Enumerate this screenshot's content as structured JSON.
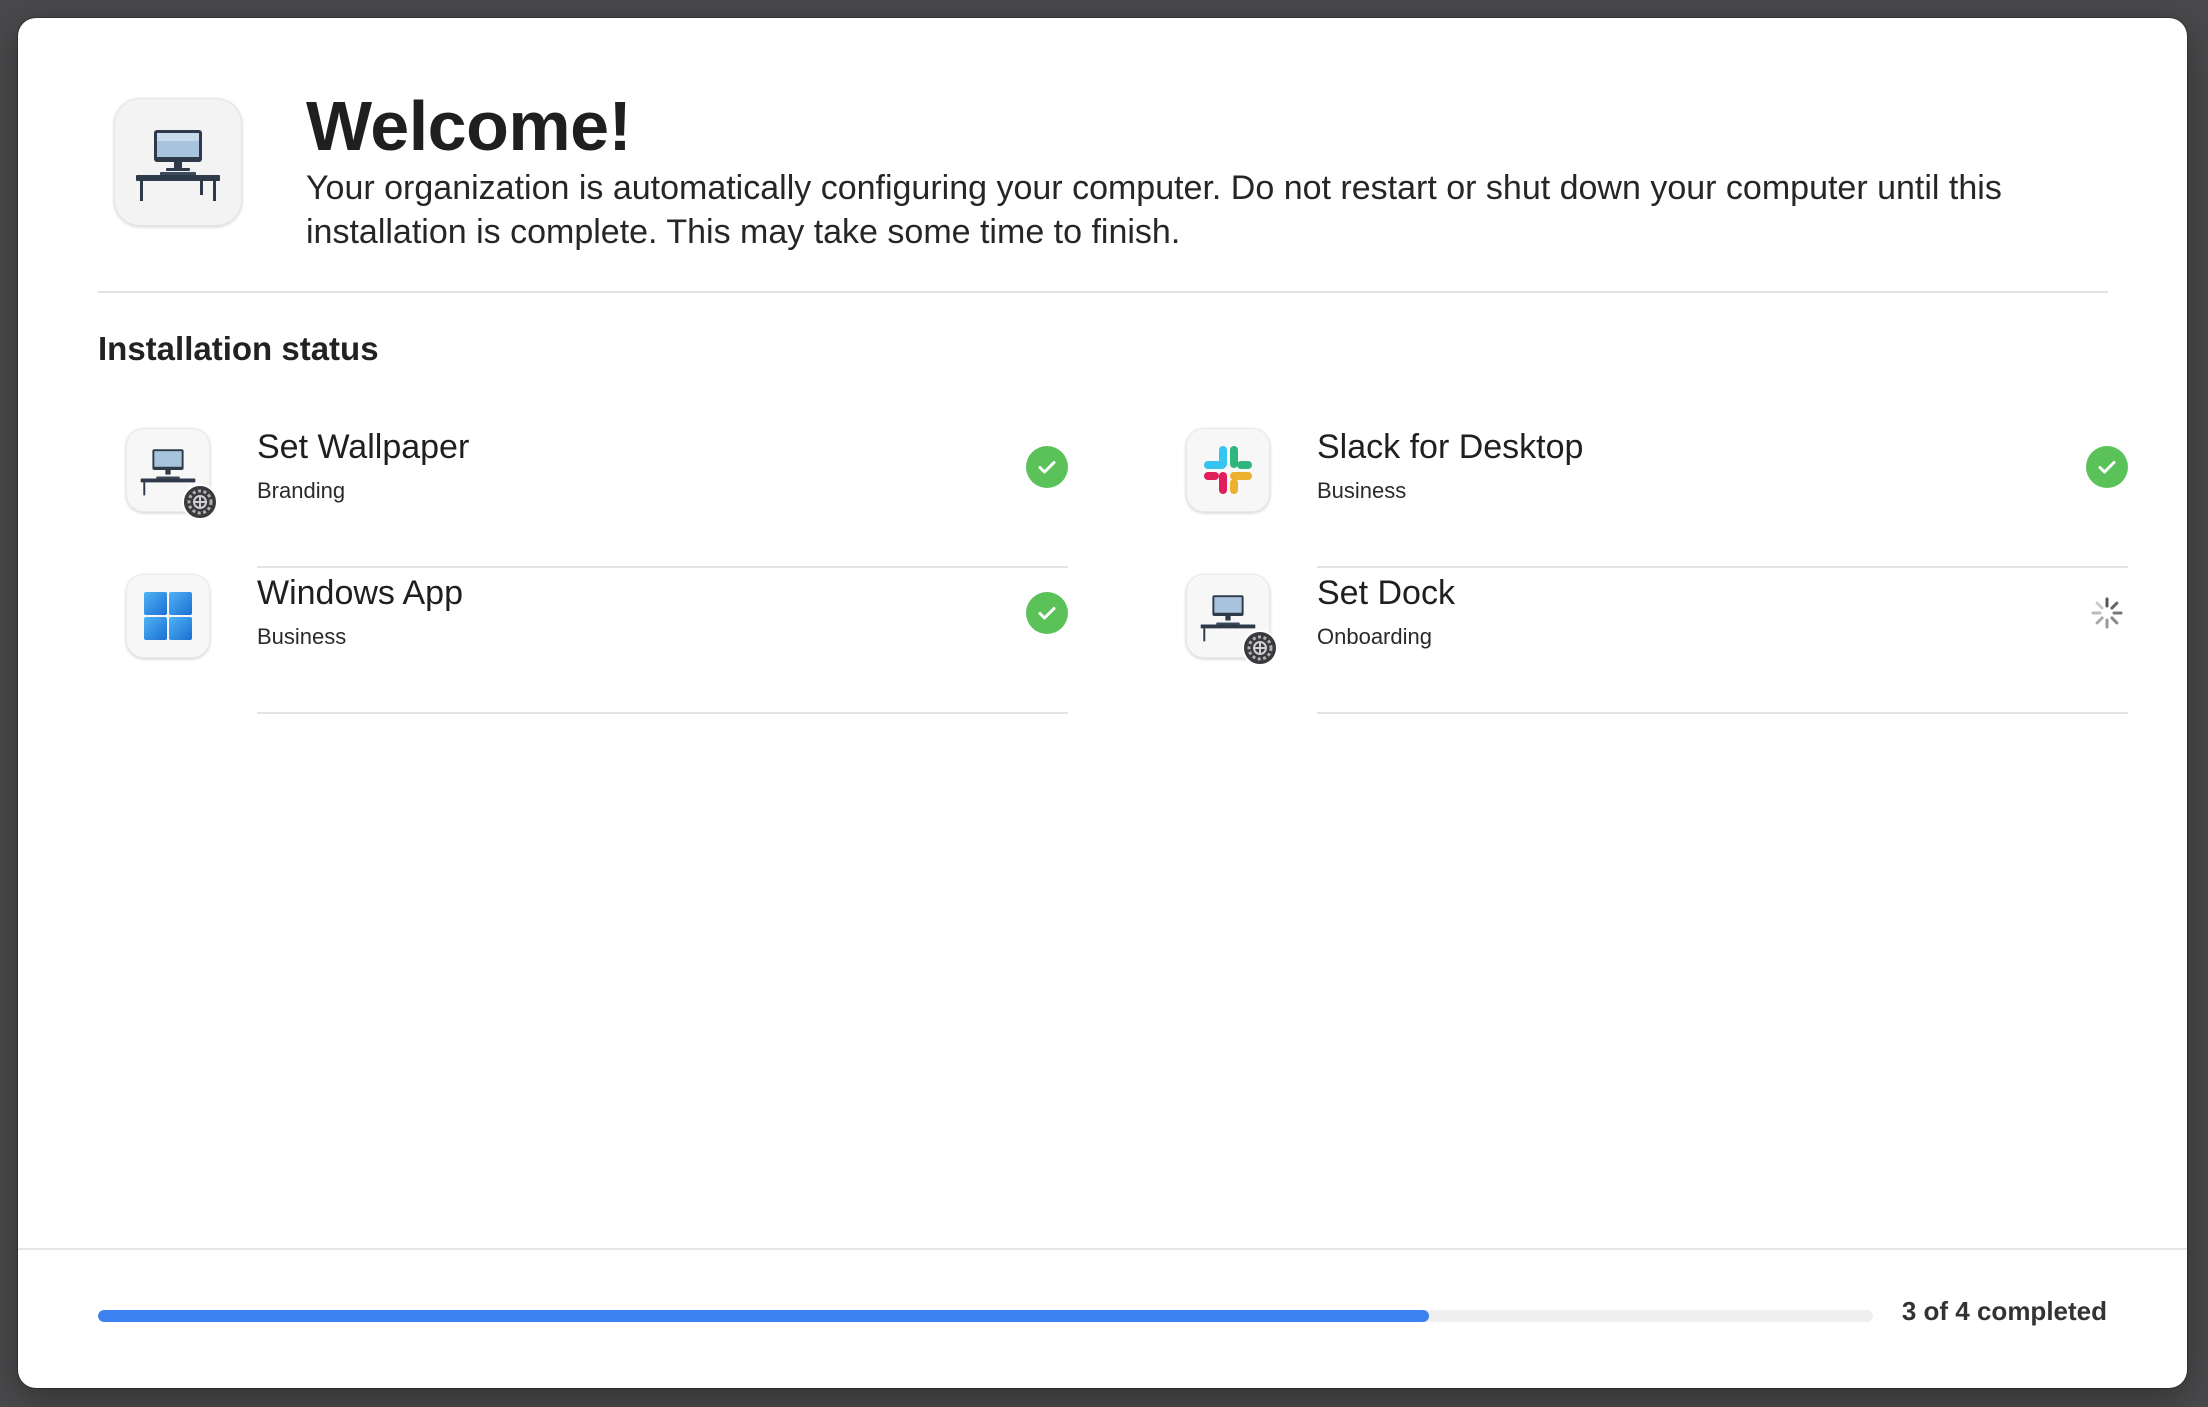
{
  "header": {
    "title": "Welcome!",
    "subtitle": "Your organization is automatically configuring your computer. Do not restart or shut down your computer until this installation is complete. This may take some time to finish.",
    "icon": "computer-desk-icon"
  },
  "section": {
    "title": "Installation status"
  },
  "items": [
    {
      "name": "Set Wallpaper",
      "category": "Branding",
      "icon": "computer-settings-icon",
      "status": "completed"
    },
    {
      "name": "Slack for Desktop",
      "category": "Business",
      "icon": "slack-icon",
      "status": "completed"
    },
    {
      "name": "Windows App",
      "category": "Business",
      "icon": "windows-icon",
      "status": "completed"
    },
    {
      "name": "Set Dock",
      "category": "Onboarding",
      "icon": "computer-settings-icon",
      "status": "in-progress"
    }
  ],
  "progress": {
    "completed": 3,
    "total": 4,
    "label": "3 of 4 completed"
  },
  "colors": {
    "accent": "#3b82f0",
    "success": "#5bc25a",
    "background": "#ffffff"
  }
}
